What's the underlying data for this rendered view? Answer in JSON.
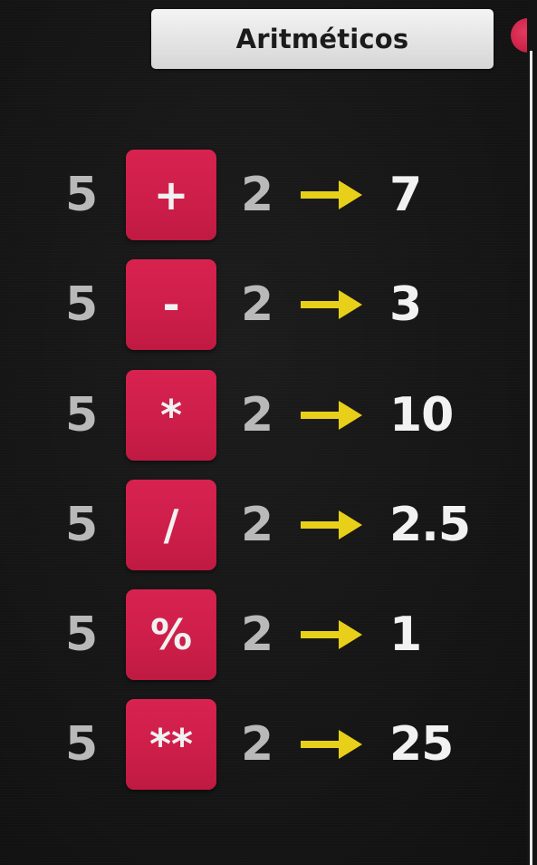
{
  "header": {
    "title": "Aritméticos"
  },
  "colors": {
    "background": "#171717",
    "operator_box": "#cc1e49",
    "arrow": "#e8cf1a",
    "operand": "#b9b9b9",
    "result": "#f2f2f2",
    "record_dot": "#c81f45"
  },
  "rows": [
    {
      "a": "5",
      "op": "+",
      "b": "2",
      "result": "7"
    },
    {
      "a": "5",
      "op": "-",
      "b": "2",
      "result": "3"
    },
    {
      "a": "5",
      "op": "*",
      "b": "2",
      "result": "10"
    },
    {
      "a": "5",
      "op": "/",
      "b": "2",
      "result": "2.5"
    },
    {
      "a": "5",
      "op": "%",
      "b": "2",
      "result": "1"
    },
    {
      "a": "5",
      "op": "**",
      "b": "2",
      "result": "25"
    }
  ]
}
